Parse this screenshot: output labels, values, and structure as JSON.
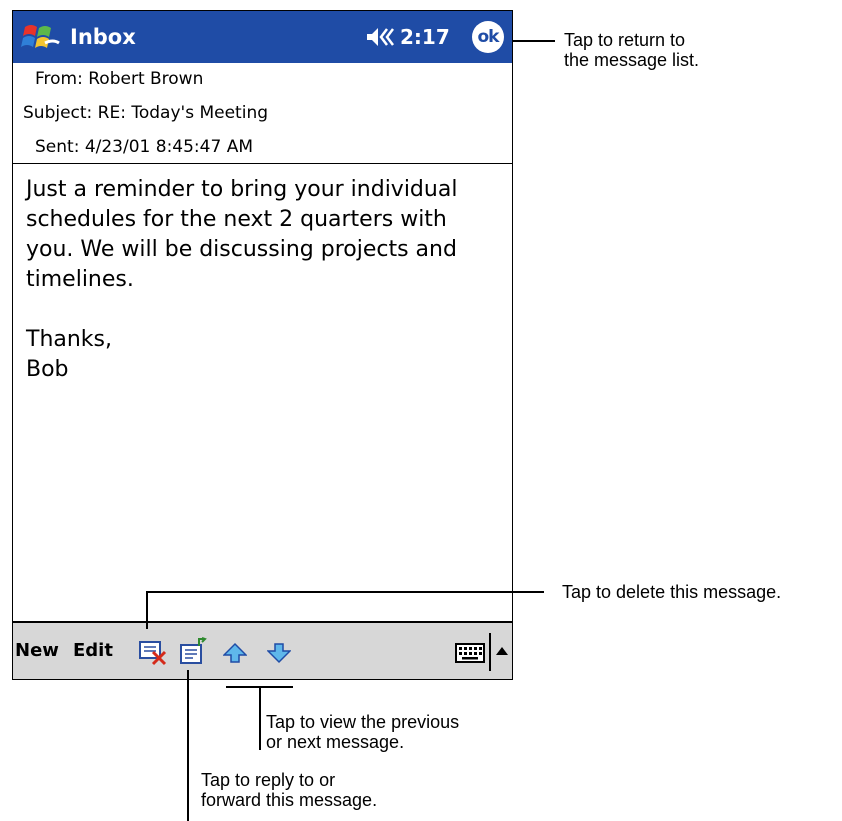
{
  "app": {
    "title": "Inbox",
    "time": "2:17",
    "ok_label": "ok"
  },
  "message": {
    "from": "From: Robert Brown",
    "subject": "Subject: RE: Today's Meeting",
    "sent": "Sent: 4/23/01 8:45:47 AM",
    "body_lines": [
      "Just a reminder to bring your individual",
      "schedules for the next 2 quarters with",
      "you. We will be discussing projects and",
      "timelines."
    ],
    "closing": "Thanks,",
    "signature": "Bob"
  },
  "toolbar": {
    "new_label": "New",
    "edit_label": "Edit"
  },
  "callouts": {
    "ok_line1": "Tap to return to",
    "ok_line2": "the message list.",
    "delete": "Tap to delete this message.",
    "nav_line1": "Tap to view  the previous",
    "nav_line2": "or next message.",
    "reply_line1": "Tap to reply to or",
    "reply_line2": "forward this message."
  },
  "icons": {
    "start": "windows-flag-icon",
    "speaker": "speaker-icon",
    "delete": "delete-message-icon",
    "reply": "reply-forward-icon",
    "previous": "up-arrow-icon",
    "next": "down-arrow-icon",
    "keyboard": "keyboard-icon",
    "sip": "input-panel-arrow-icon"
  },
  "colors": {
    "titlebar": "#1f4ca6",
    "toolbar": "#d7d7d7"
  }
}
